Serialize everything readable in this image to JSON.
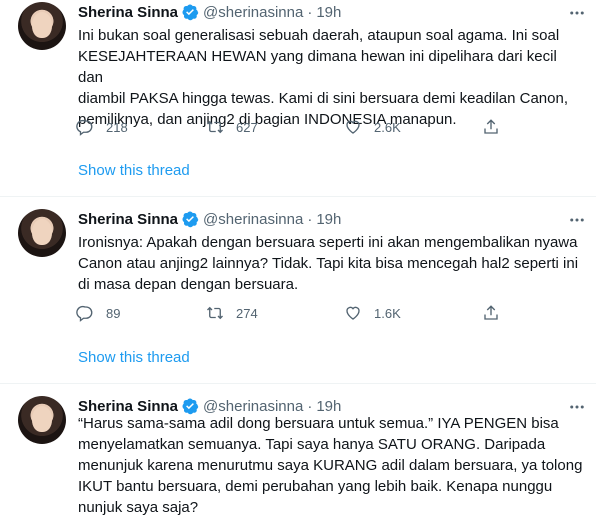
{
  "tweets": [
    {
      "author": "Sherina Sinna",
      "handle": "@sherinasinna",
      "separator": "·",
      "time": "19h",
      "text": "Ini bukan soal generalisasi sebuah daerah, ataupun soal agama. Ini soal\nKESEJAHTERAAN HEWAN yang dimana hewan ini dipelihara dari kecil dan\ndiambil PAKSA hingga tewas. Kami di sini bersuara demi keadilan Canon,\npemiliknya, dan anjing2 di bagian INDONESIA manapun.",
      "replies": "218",
      "retweets": "627",
      "likes": "2.6K",
      "thread_link": "Show this thread"
    },
    {
      "author": "Sherina Sinna",
      "handle": "@sherinasinna",
      "separator": "·",
      "time": "19h",
      "text": "Ironisnya: Apakah dengan bersuara seperti ini akan mengembalikan nyawa\nCanon atau anjing2 lainnya? Tidak. Tapi kita bisa mencegah hal2 seperti ini\ndi masa depan dengan bersuara.",
      "replies": "89",
      "retweets": "274",
      "likes": "1.6K",
      "thread_link": "Show this thread"
    },
    {
      "author": "Sherina Sinna",
      "handle": "@sherinasinna",
      "separator": "·",
      "time": "19h",
      "text": "“Harus sama-sama adil dong bersuara untuk semua.” IYA PENGEN bisa\nmenyelamatkan semuanya. Tapi saya hanya SATU ORANG. Daripada\nmenunjuk karena menurutmu saya KURANG adil dalam bersuara, ya tolong\nIKUT bantu bersuara, demi perubahan yang lebih baik. Kenapa nunggu\nnunjuk saya saja?"
    }
  ],
  "colors": {
    "verified": "#1d9bf0",
    "link": "#1d9bf0",
    "muted": "#536471",
    "divider": "#eff3f4"
  },
  "icons": [
    "reply-icon",
    "retweet-icon",
    "like-icon",
    "share-icon",
    "verified-badge-icon",
    "more-icon"
  ]
}
